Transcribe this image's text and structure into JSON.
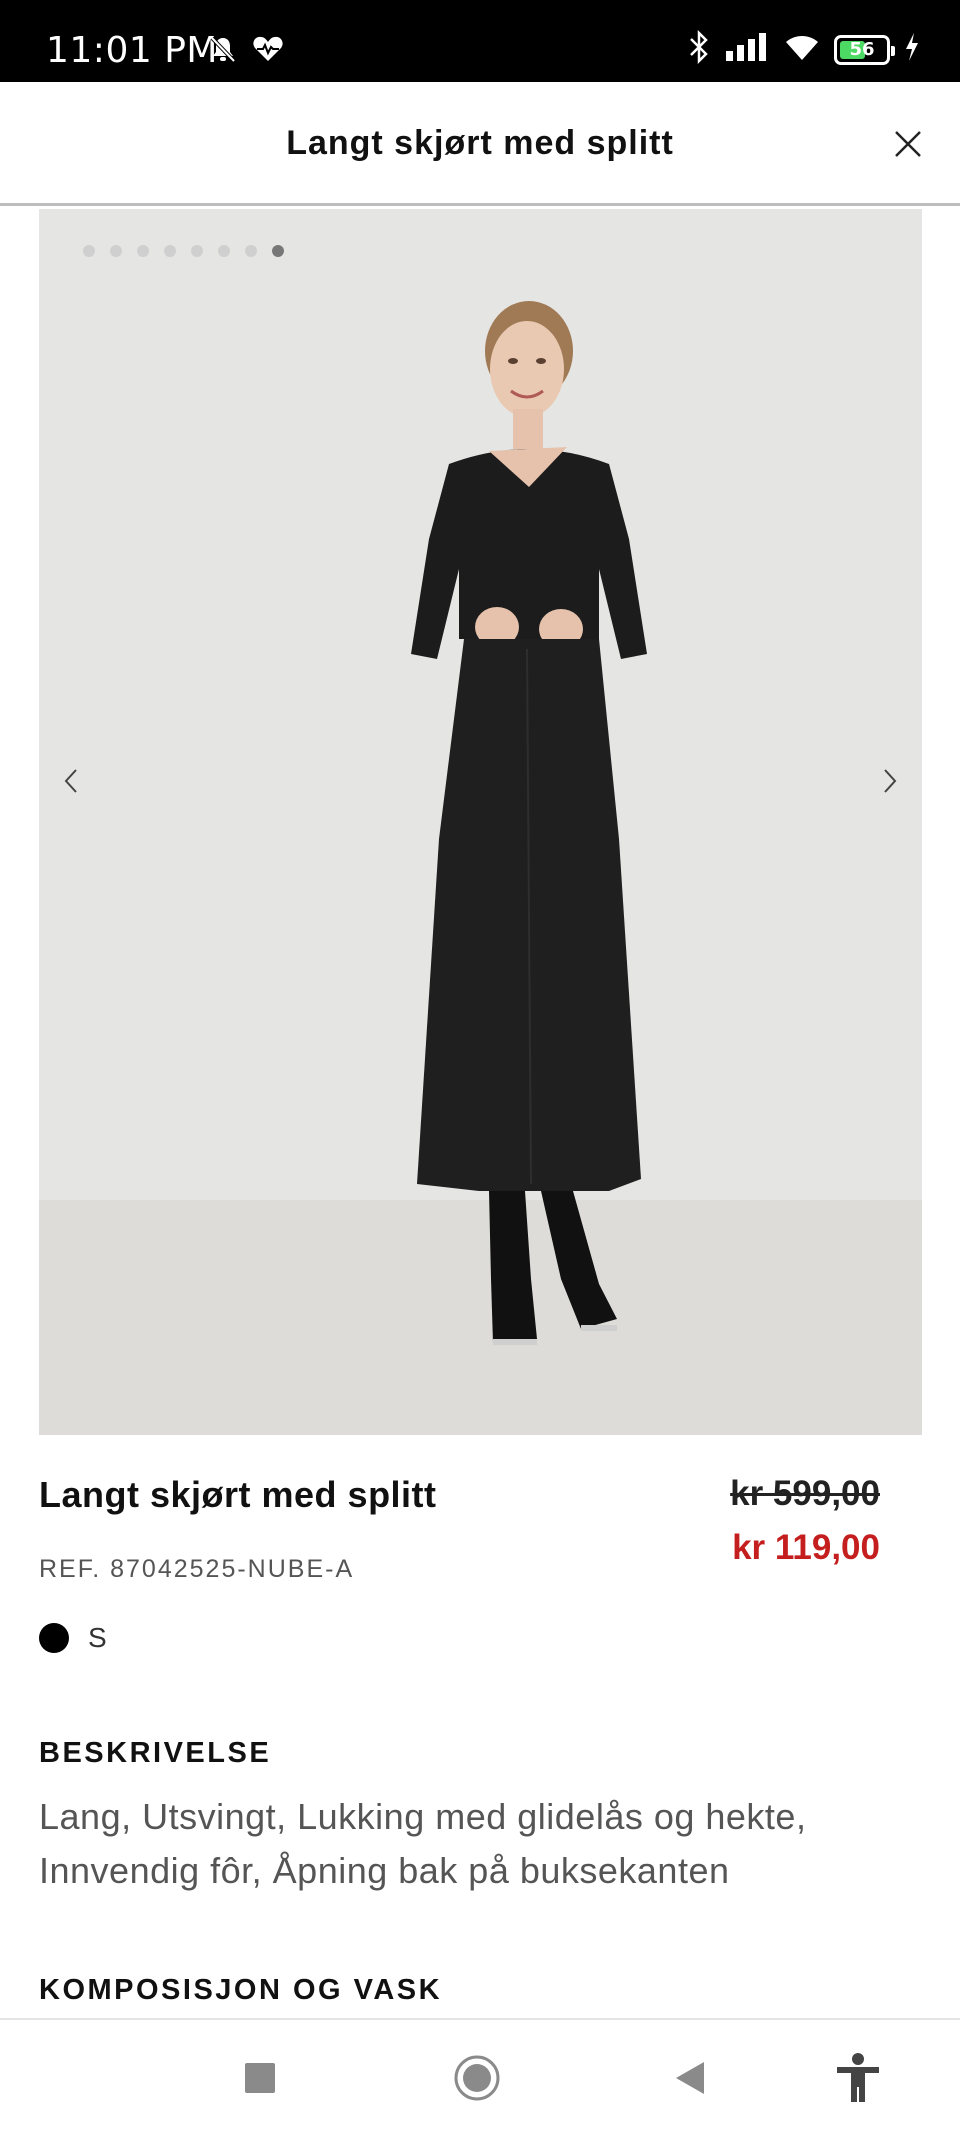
{
  "status_bar": {
    "time": "11:01 PM",
    "battery_level": "56",
    "battery_fraction": 0.56,
    "icons": [
      "mute-bell-icon",
      "health-heart-icon",
      "bluetooth-icon",
      "signal-icon",
      "wifi-icon",
      "battery-icon",
      "charging-icon"
    ]
  },
  "header": {
    "title": "Langt skjørt med splitt",
    "close_icon": "close-icon"
  },
  "gallery": {
    "image_count": 8,
    "active_index": 7,
    "prev_icon": "chevron-left-icon",
    "next_icon": "chevron-right-icon"
  },
  "product": {
    "name": "Langt skjørt med splitt",
    "price_original": "kr 599,00",
    "price_sale": "kr 119,00",
    "ref": "REF. 87042525-NUBE-A",
    "color_swatch": "#000000",
    "size": "S"
  },
  "description": {
    "heading": "BESKRIVELSE",
    "text": "Lang, Utsvingt, Lukking med glidelås og hekte, Innvendig fôr, Åpning bak på buksekanten"
  },
  "composition": {
    "heading": "KOMPOSISJON OG VASK"
  },
  "nav_bar": {
    "buttons": [
      "recents-square-icon",
      "home-circle-icon",
      "back-triangle-icon",
      "accessibility-icon"
    ]
  },
  "colors": {
    "sale_red": "#c41e1e",
    "gallery_bg": "#e5e5e3",
    "battery_green": "#4cd964"
  }
}
